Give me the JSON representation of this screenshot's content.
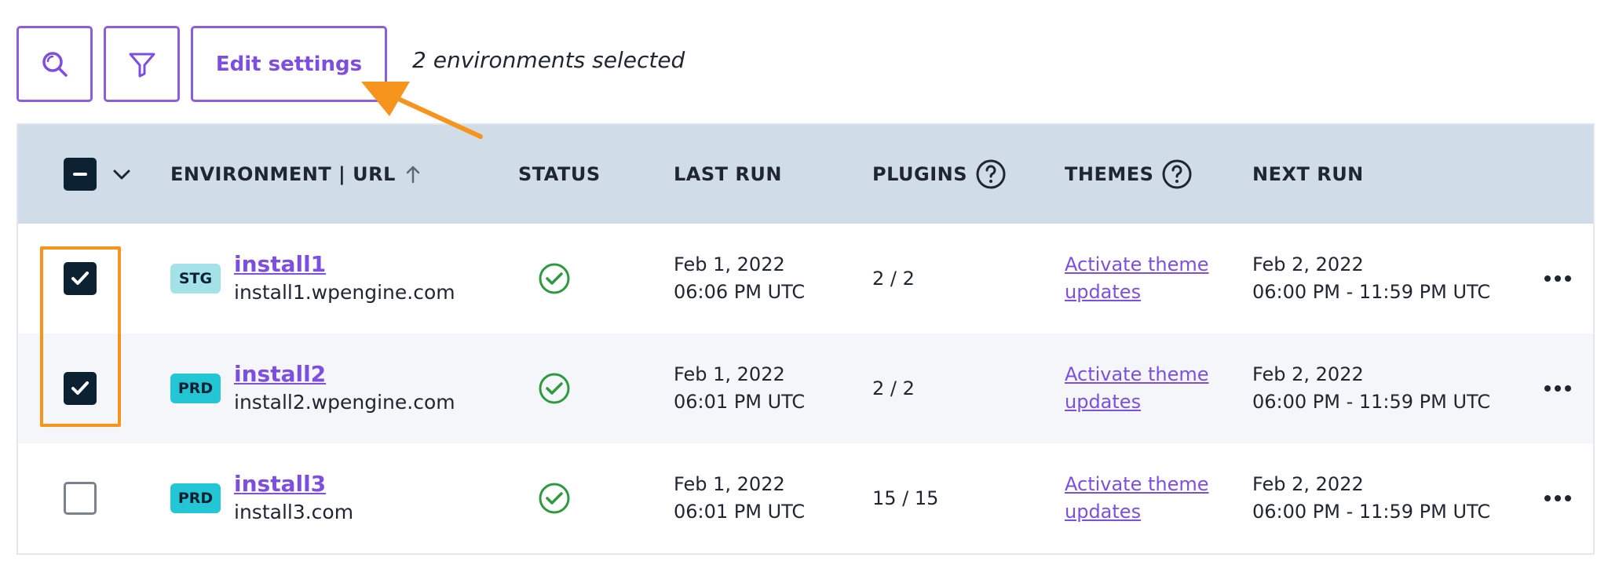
{
  "toolbar": {
    "edit_settings_label": "Edit settings",
    "selection_note": "2 environments selected"
  },
  "table": {
    "headers": {
      "environment": "ENVIRONMENT | URL",
      "status": "STATUS",
      "last_run": "LAST RUN",
      "plugins": "PLUGINS",
      "themes": "THEMES",
      "next_run": "NEXT RUN"
    },
    "rows": [
      {
        "selected": true,
        "env_type": "STG",
        "env_color": "#a3e3e8",
        "name": "install1",
        "url": "install1.wpengine.com",
        "last_run_date": "Feb 1, 2022",
        "last_run_time": "06:06 PM UTC",
        "plugins": "2 / 2",
        "themes_line1": "Activate theme",
        "themes_line2": "updates",
        "next_run_date": "Feb 2, 2022",
        "next_run_window": "06:00 PM - 11:59 PM UTC"
      },
      {
        "selected": true,
        "env_type": "PRD",
        "env_color": "#22c6d4",
        "name": "install2",
        "url": "install2.wpengine.com",
        "last_run_date": "Feb 1, 2022",
        "last_run_time": "06:01 PM UTC",
        "plugins": "2 / 2",
        "themes_line1": "Activate theme",
        "themes_line2": "updates",
        "next_run_date": "Feb 2, 2022",
        "next_run_window": "06:00 PM - 11:59 PM UTC"
      },
      {
        "selected": false,
        "env_type": "PRD",
        "env_color": "#22c6d4",
        "name": "install3",
        "url": "install3.com",
        "last_run_date": "Feb 1, 2022",
        "last_run_time": "06:01 PM UTC",
        "plugins": "15 / 15",
        "themes_line1": "Activate theme",
        "themes_line2": "updates",
        "next_run_date": "Feb 2, 2022",
        "next_run_window": "06:00 PM - 11:59 PM UTC"
      }
    ]
  },
  "colors": {
    "accent": "#7c4fe0",
    "header_bg": "#d0dde8",
    "success": "#2e9a3e",
    "annotation": "#f7941d",
    "checkbox_on": "#0c2233"
  },
  "icons": [
    "search-icon",
    "filter-icon",
    "minus-icon",
    "chevron-down-icon",
    "sort-up-icon",
    "help-icon",
    "check-icon",
    "status-success-icon",
    "more-icon",
    "arrow-annotation"
  ]
}
